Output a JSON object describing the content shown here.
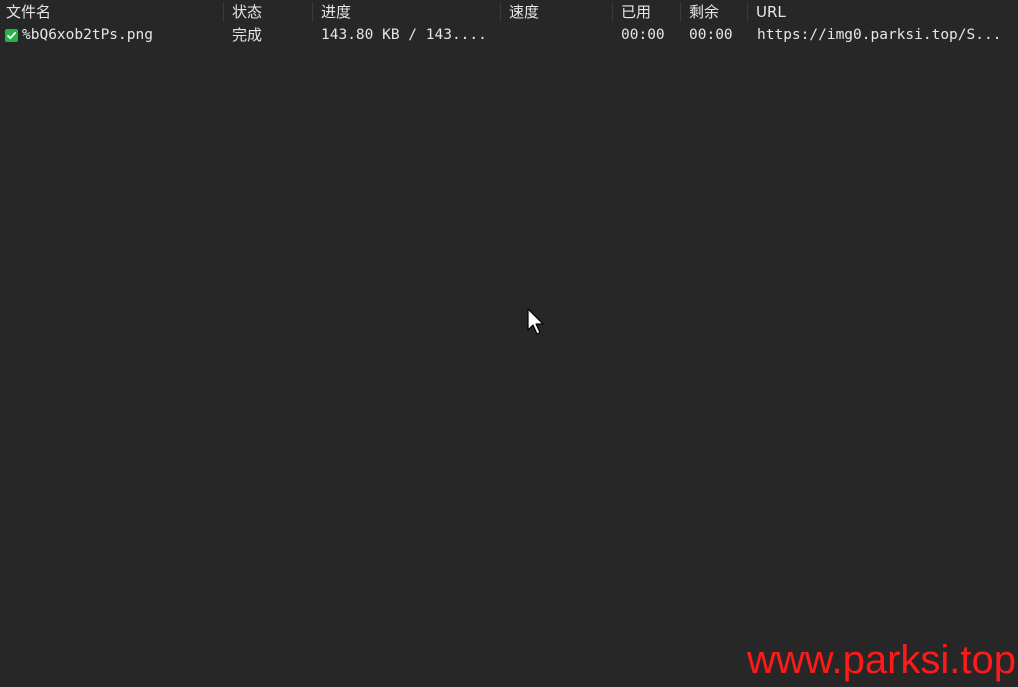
{
  "columns": {
    "filename": "文件名",
    "status": "状态",
    "progress": "进度",
    "speed": "速度",
    "elapsed": "已用",
    "remaining": "剩余",
    "url": "URL"
  },
  "rows": [
    {
      "filename": "%bQ6xob2tPs.png",
      "status": "完成",
      "progress": "143.80 KB / 143....",
      "speed": "",
      "elapsed": "00:00",
      "remaining": "00:00",
      "url": "https://img0.parksi.top/S...",
      "icon": "check-icon"
    }
  ],
  "watermark": "www.parksi.top",
  "colors": {
    "background": "#272727",
    "text": "#e6e6e6",
    "check": "#24b34a",
    "watermark": "#ff1a1a"
  }
}
